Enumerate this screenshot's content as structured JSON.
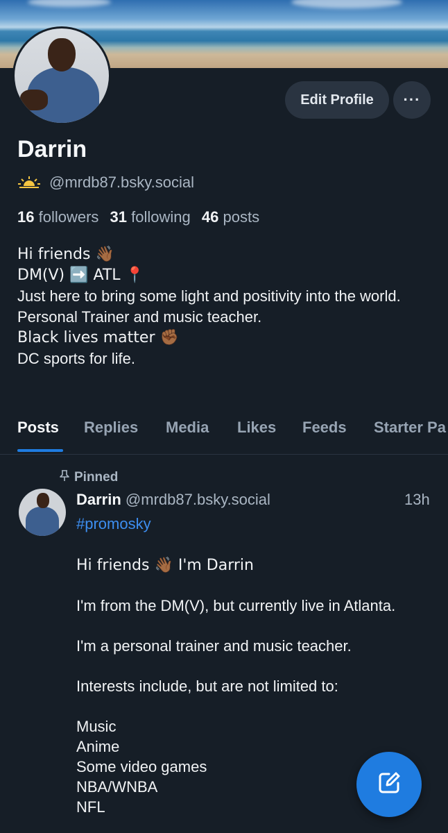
{
  "profile": {
    "name": "Darrin",
    "handle": "@mrdb87.bsky.social",
    "edit_label": "Edit Profile",
    "more_label": "···",
    "stats": {
      "followers_count": "16",
      "followers_label": "followers",
      "following_count": "31",
      "following_label": "following",
      "posts_count": "46",
      "posts_label": "posts"
    },
    "bio": [
      "Hi friends 👋🏾",
      "DM(V) ➡️ ATL 📍",
      "Just here to bring some light and positivity into the world.",
      "Personal Trainer and music teacher.",
      "Black lives matter ✊🏾",
      "DC sports for life."
    ]
  },
  "tabs": [
    "Posts",
    "Replies",
    "Media",
    "Likes",
    "Feeds",
    "Starter Pa"
  ],
  "active_tab": "Posts",
  "post": {
    "pinned_label": "Pinned",
    "author": "Darrin",
    "handle": "@mrdb87.bsky.social",
    "time": "13h",
    "hashtag": "#promosky",
    "lines": [
      "Hi friends 👋🏾 I'm Darrin",
      "",
      "I'm from the DM(V), but currently live in Atlanta.",
      "",
      "I'm a personal trainer and music teacher.",
      "",
      "Interests include, but are not limited to:",
      "",
      "Music",
      "Anime",
      "Some video games",
      "NBA/WNBA",
      "NFL"
    ]
  },
  "icons": {
    "handle_prefix": "sunrise-icon",
    "pinned": "pin-icon",
    "compose": "compose-icon",
    "more": "ellipsis-icon"
  },
  "colors": {
    "background": "#161e27",
    "accent": "#1f7ce0",
    "link": "#3d8ef0"
  }
}
